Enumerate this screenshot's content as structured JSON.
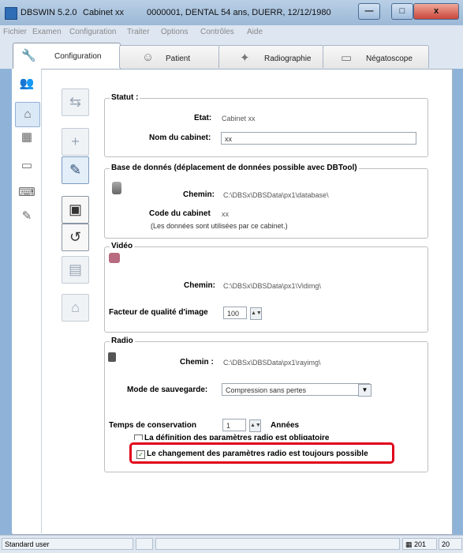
{
  "window": {
    "app": "DBSWIN 5.2.0",
    "cabinet": "Cabinet xx",
    "patient": "0000001, DENTAL 54 ans, DUERR, 12/12/1980",
    "min_icon": "minimize-icon",
    "close_icon": "close-icon"
  },
  "menu": [
    "Fichier",
    "Examen",
    "Configuration",
    "Traiter",
    "Options",
    "Contrôles",
    "Aide"
  ],
  "tabs": [
    {
      "label": "Configuration",
      "icon": "wrench-icon"
    },
    {
      "label": "Patient",
      "icon": "patient-icon"
    },
    {
      "label": "Radiographie",
      "icon": "radiography-icon"
    },
    {
      "label": "Négatoscope",
      "icon": "viewer-icon"
    }
  ],
  "statut": {
    "title": "Statut :",
    "etat_label": "Etat:",
    "etat_value": "Cabinet xx",
    "nom_label": "Nom du cabinet:",
    "nom_value": "xx"
  },
  "base": {
    "title": "Base de donnés (déplacement de données possible avec DBTool)",
    "chemin_label": "Chemin:",
    "chemin_value": "C:\\DBSx\\DBSData\\px1\\database\\",
    "code_label": "Code du cabinet",
    "code_value": "xx",
    "note": "(Les données sont utilisées par ce cabinet.)"
  },
  "video": {
    "title": "Vidéo",
    "chemin_label": "Chemin:",
    "chemin_value": "C:\\DBSx\\DBSData\\px1\\Vidimg\\",
    "facteur_label": "Facteur de qualité d'image",
    "facteur_value": "100"
  },
  "radio": {
    "title": "Radio",
    "chemin_label": "Chemin :",
    "chemin_value": "C:\\DBSx\\DBSData\\px1\\rayimg\\",
    "mode_label": "Mode de sauvegarde:",
    "mode_value": "Compression sans pertes",
    "temps_label": "Temps de conservation",
    "temps_value": "1",
    "temps_unit": "Années",
    "check1_label": "La définition des paramètres radio est obligatoire",
    "check2_label": "Le changement des paramètres radio est toujours possible",
    "check2_mark": "✓"
  },
  "status": {
    "user": "Standard user",
    "right1": "201",
    "right2": "20"
  }
}
